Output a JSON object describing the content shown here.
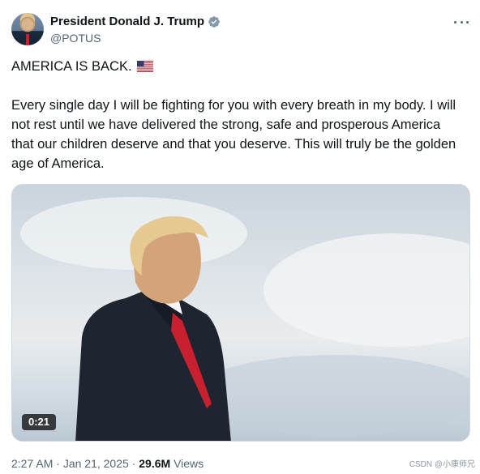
{
  "author": {
    "display_name": "President Donald J. Trump",
    "handle": "@POTUS",
    "verified_badge_color": "#829aab",
    "icons": {
      "verified": "verified-badge-icon",
      "more": "more-options-icon"
    }
  },
  "tweet": {
    "line1": "AMERICA IS BACK.",
    "line1_emoji": "us-flag-emoji",
    "body": "Every single day I will be fighting for you with every breath in my body. I will not rest until we have delivered the strong, safe and prosperous America that our children deserve and that you deserve. This will truly be the golden age of America."
  },
  "media": {
    "type": "video",
    "duration": "0:21"
  },
  "meta": {
    "time": "2:27 AM",
    "separator": "·",
    "date": "Jan 21, 2025",
    "views_count": "29.6M",
    "views_label": "Views"
  },
  "watermark": "CSDN @小康师兄",
  "colors": {
    "text": "#0f1419",
    "secondary": "#536471",
    "tie": "#c8202f"
  }
}
